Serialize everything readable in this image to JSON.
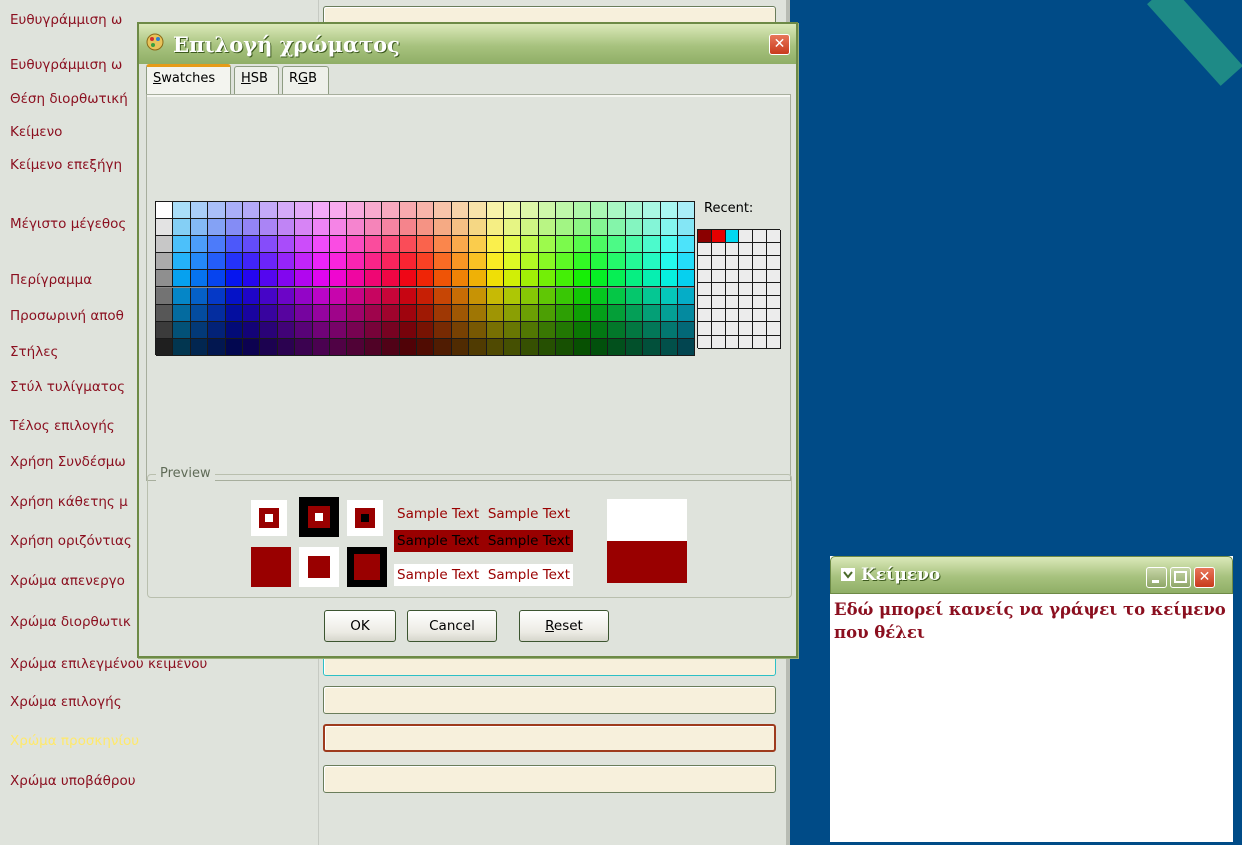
{
  "properties_panel": {
    "labels": [
      "Ευθυγράμμιση ω",
      "Ευθυγράμμιση ω",
      "Θέση διορθωτική",
      "Κείμενο",
      "Κείμενο επεξήγη",
      "Μέγιστο μέγεθος",
      "Περίγραμμα",
      "Προσωρινή αποθ",
      "Στήλες",
      "Στύλ τυλίγματος",
      "Τέλος επιλογής",
      "Χρήση Συνδέσμω",
      "Χρήση κάθετης μ",
      "Χρήση οριζόντιας",
      "Χρώμα απενεργο",
      "Χρώμα διορθωτικ",
      "Χρώμα επιλεγμένου κειμένου",
      "Χρώμα επιλογής",
      "Χρώμα προσκηνίου",
      "Χρώμα υποβάθρου"
    ]
  },
  "color_dialog": {
    "title": "Επιλογή χρώματος",
    "close_glyph": "✕",
    "tabs": [
      {
        "label_u": "S",
        "label_rest": "watches"
      },
      {
        "label_u": "H",
        "label_rest": "SB"
      },
      {
        "label_pre": "R",
        "label_u": "G",
        "label_rest": "B"
      }
    ],
    "recent_label": "Recent:",
    "recent_colors": [
      "#8b0000",
      "#e60000",
      "#00d8f0"
    ],
    "preview_legend": "Preview",
    "sample_text": "Sample Text",
    "preview_color": "#990000",
    "buttons": {
      "ok": "OK",
      "cancel": "Cancel",
      "reset_u": "R",
      "reset_rest": "eset"
    }
  },
  "text_window": {
    "title": "Κείμενο",
    "body_line1": "Εδώ μπορεί κανείς να γράψει το κείμενο",
    "body_line2": "που θέλει",
    "text_color": "#8b0f1f"
  }
}
